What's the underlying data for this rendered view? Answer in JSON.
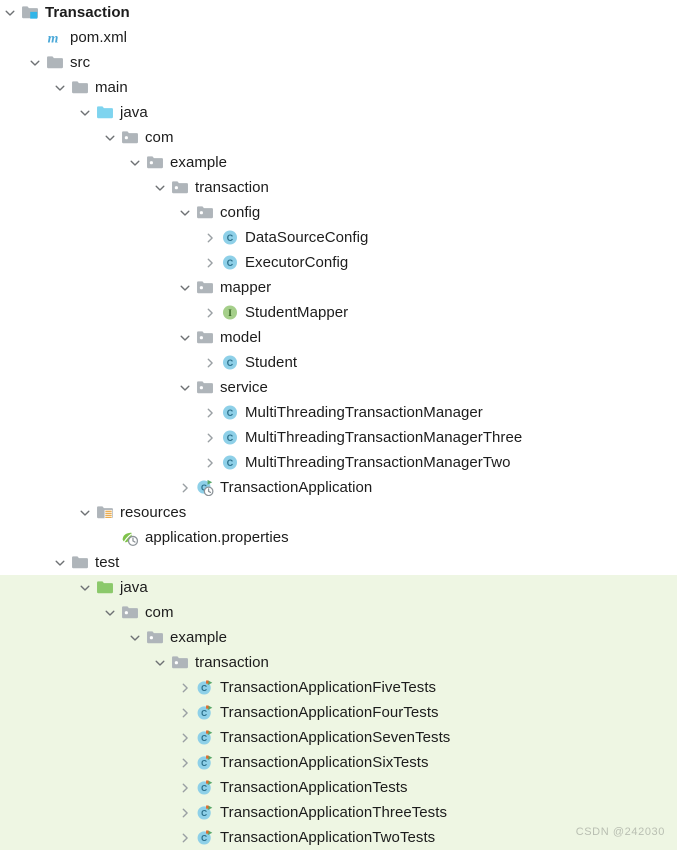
{
  "colors": {
    "selection_background": "#eef6e3",
    "class_icon_fill": "#8ed0e8",
    "class_icon_letter": "#2b6f8a",
    "interface_icon_fill": "#a5cf8a",
    "interface_icon_letter": "#31611f",
    "folder_gray": "#afb5ba",
    "folder_source_blue": "#7fd4ef",
    "folder_test_green": "#8bc96b",
    "maven_blue": "#4aa8d8",
    "run_arrow_green": "#59a869",
    "resources_orange": "#e8a33d",
    "watermark": "#b9bfb2"
  },
  "watermark": "CSDN @242030",
  "tree": [
    {
      "id": "transaction-module",
      "label": "Transaction",
      "depth": 0,
      "icon": "module-icon",
      "chevron": "expanded",
      "bold": true,
      "selected": false
    },
    {
      "id": "pom-xml",
      "label": "pom.xml",
      "depth": 1,
      "icon": "maven-file-icon",
      "chevron": "none",
      "bold": false,
      "selected": false
    },
    {
      "id": "src",
      "label": "src",
      "depth": 1,
      "icon": "folder-icon",
      "chevron": "expanded",
      "bold": false,
      "selected": false
    },
    {
      "id": "main",
      "label": "main",
      "depth": 2,
      "icon": "folder-icon",
      "chevron": "expanded",
      "bold": false,
      "selected": false
    },
    {
      "id": "main-java",
      "label": "java",
      "depth": 3,
      "icon": "source-root-icon",
      "chevron": "expanded",
      "bold": false,
      "selected": false
    },
    {
      "id": "main-com",
      "label": "com",
      "depth": 4,
      "icon": "package-icon",
      "chevron": "expanded",
      "bold": false,
      "selected": false
    },
    {
      "id": "main-example",
      "label": "example",
      "depth": 5,
      "icon": "package-icon",
      "chevron": "expanded",
      "bold": false,
      "selected": false
    },
    {
      "id": "main-transaction",
      "label": "transaction",
      "depth": 6,
      "icon": "package-icon",
      "chevron": "expanded",
      "bold": false,
      "selected": false
    },
    {
      "id": "config",
      "label": "config",
      "depth": 7,
      "icon": "package-icon",
      "chevron": "expanded",
      "bold": false,
      "selected": false
    },
    {
      "id": "datasourceconfig",
      "label": "DataSourceConfig",
      "depth": 8,
      "icon": "class-icon",
      "chevron": "collapsed",
      "bold": false,
      "selected": false
    },
    {
      "id": "executorconfig",
      "label": "ExecutorConfig",
      "depth": 8,
      "icon": "class-icon",
      "chevron": "collapsed",
      "bold": false,
      "selected": false
    },
    {
      "id": "mapper",
      "label": "mapper",
      "depth": 7,
      "icon": "package-icon",
      "chevron": "expanded",
      "bold": false,
      "selected": false
    },
    {
      "id": "studentmapper",
      "label": "StudentMapper",
      "depth": 8,
      "icon": "interface-icon",
      "chevron": "collapsed",
      "bold": false,
      "selected": false
    },
    {
      "id": "model",
      "label": "model",
      "depth": 7,
      "icon": "package-icon",
      "chevron": "expanded",
      "bold": false,
      "selected": false
    },
    {
      "id": "student",
      "label": "Student",
      "depth": 8,
      "icon": "class-icon",
      "chevron": "collapsed",
      "bold": false,
      "selected": false
    },
    {
      "id": "service",
      "label": "service",
      "depth": 7,
      "icon": "package-icon",
      "chevron": "expanded",
      "bold": false,
      "selected": false
    },
    {
      "id": "mttm",
      "label": "MultiThreadingTransactionManager",
      "depth": 8,
      "icon": "class-icon",
      "chevron": "collapsed",
      "bold": false,
      "selected": false
    },
    {
      "id": "mttm-three",
      "label": "MultiThreadingTransactionManagerThree",
      "depth": 8,
      "icon": "class-icon",
      "chevron": "collapsed",
      "bold": false,
      "selected": false
    },
    {
      "id": "mttm-two",
      "label": "MultiThreadingTransactionManagerTwo",
      "depth": 8,
      "icon": "class-icon",
      "chevron": "collapsed",
      "bold": false,
      "selected": false
    },
    {
      "id": "transactionapplication",
      "label": "TransactionApplication",
      "depth": 7,
      "icon": "spring-boot-class-icon",
      "chevron": "collapsed",
      "bold": false,
      "selected": false
    },
    {
      "id": "resources",
      "label": "resources",
      "depth": 3,
      "icon": "resources-folder-icon",
      "chevron": "expanded",
      "bold": false,
      "selected": false
    },
    {
      "id": "application-properties",
      "label": "application.properties",
      "depth": 4,
      "icon": "spring-properties-icon",
      "chevron": "none",
      "bold": false,
      "selected": false
    },
    {
      "id": "test",
      "label": "test",
      "depth": 2,
      "icon": "folder-icon",
      "chevron": "expanded",
      "bold": false,
      "selected": false
    },
    {
      "id": "test-java",
      "label": "java",
      "depth": 3,
      "icon": "test-root-icon",
      "chevron": "expanded",
      "bold": false,
      "selected": true
    },
    {
      "id": "test-com",
      "label": "com",
      "depth": 4,
      "icon": "package-icon",
      "chevron": "expanded",
      "bold": false,
      "selected": true
    },
    {
      "id": "test-example",
      "label": "example",
      "depth": 5,
      "icon": "package-icon",
      "chevron": "expanded",
      "bold": false,
      "selected": true
    },
    {
      "id": "test-transaction",
      "label": "transaction",
      "depth": 6,
      "icon": "package-icon",
      "chevron": "expanded",
      "bold": false,
      "selected": true
    },
    {
      "id": "test-five",
      "label": "TransactionApplicationFiveTests",
      "depth": 7,
      "icon": "test-class-icon",
      "chevron": "collapsed",
      "bold": false,
      "selected": true
    },
    {
      "id": "test-four",
      "label": "TransactionApplicationFourTests",
      "depth": 7,
      "icon": "test-class-icon",
      "chevron": "collapsed",
      "bold": false,
      "selected": true
    },
    {
      "id": "test-seven",
      "label": "TransactionApplicationSevenTests",
      "depth": 7,
      "icon": "test-class-icon",
      "chevron": "collapsed",
      "bold": false,
      "selected": true
    },
    {
      "id": "test-six",
      "label": "TransactionApplicationSixTests",
      "depth": 7,
      "icon": "test-class-icon",
      "chevron": "collapsed",
      "bold": false,
      "selected": true
    },
    {
      "id": "test-main",
      "label": "TransactionApplicationTests",
      "depth": 7,
      "icon": "test-class-icon",
      "chevron": "collapsed",
      "bold": false,
      "selected": true
    },
    {
      "id": "test-three",
      "label": "TransactionApplicationThreeTests",
      "depth": 7,
      "icon": "test-class-icon",
      "chevron": "collapsed",
      "bold": false,
      "selected": true
    },
    {
      "id": "test-two",
      "label": "TransactionApplicationTwoTests",
      "depth": 7,
      "icon": "test-class-icon",
      "chevron": "collapsed",
      "bold": false,
      "selected": true
    }
  ]
}
